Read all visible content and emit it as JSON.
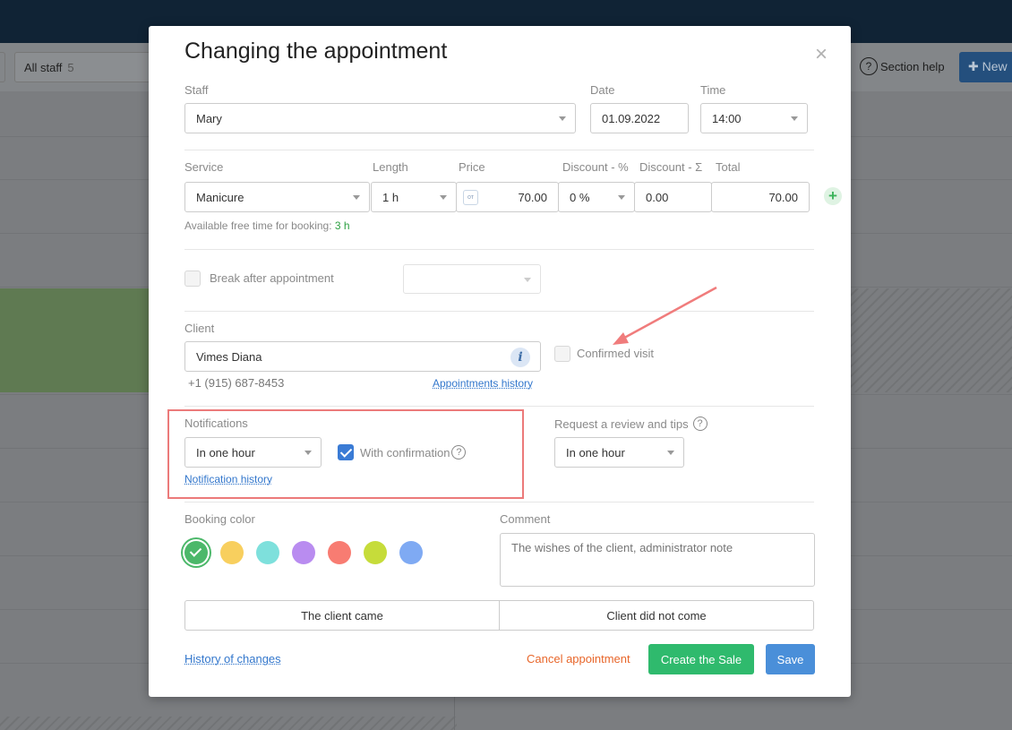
{
  "background": {
    "staff_filter_label": "All staff",
    "staff_filter_count": "5",
    "section_help_label": "Section help",
    "new_button_label": "New"
  },
  "modal": {
    "title": "Changing the appointment",
    "close_label": "×",
    "staff": {
      "label": "Staff",
      "value": "Mary"
    },
    "date": {
      "label": "Date",
      "value": "01.09.2022"
    },
    "time": {
      "label": "Time",
      "value": "14:00"
    },
    "service_table": {
      "headers": {
        "service": "Service",
        "length": "Length",
        "price": "Price",
        "discount_pct": "Discount - %",
        "discount_sum": "Discount - Σ",
        "total": "Total"
      },
      "row": {
        "service": "Manicure",
        "length": "1 h",
        "price_currency_icon": "от",
        "price": "70.00",
        "discount_pct": "0 %",
        "discount_sum": "0.00",
        "total": "70.00"
      },
      "add_icon": "+"
    },
    "free_time": {
      "label": "Available free time for booking:",
      "value": "3 h"
    },
    "break_after": {
      "label": "Break after appointment",
      "checked": false
    },
    "client": {
      "label": "Client",
      "name": "Vimes Diana",
      "phone": "+1 (915) 687-8453",
      "info_icon": "i",
      "history_link": "Appointments history"
    },
    "confirmed_visit": {
      "label": "Confirmed visit",
      "checked": false
    },
    "notifications": {
      "label": "Notifications",
      "value": "In one hour",
      "with_confirmation_label": "With confirmation",
      "with_confirmation_checked": true,
      "history_link": "Notification history"
    },
    "review": {
      "label": "Request a review and tips",
      "value": "In one hour"
    },
    "help_icon": "?",
    "booking_color": {
      "label": "Booking color",
      "colors": [
        "#4cb86a",
        "#f8cf5e",
        "#7ee0dc",
        "#b98cf0",
        "#f87c72",
        "#c6dc3a",
        "#7faaf3"
      ],
      "selected_index": 0
    },
    "comment": {
      "label": "Comment",
      "placeholder": "The wishes of the client, administrator note"
    },
    "client_came_label": "The client came",
    "client_not_come_label": "Client did not come",
    "history_link": "History of changes",
    "cancel_label": "Cancel appointment",
    "create_sale_label": "Create the Sale",
    "save_label": "Save"
  }
}
